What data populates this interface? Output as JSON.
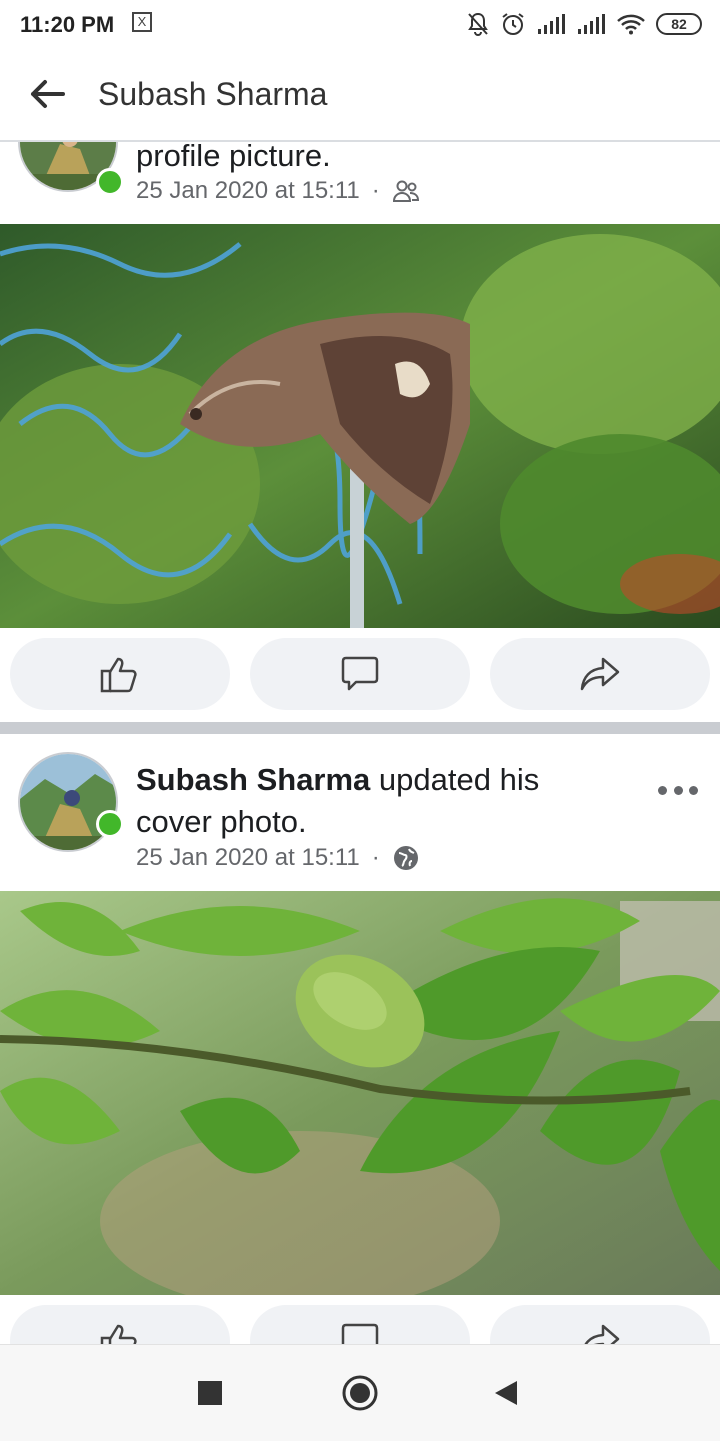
{
  "status_bar": {
    "time": "11:20 PM",
    "notification_glyph": "X",
    "battery": "82",
    "icons": [
      "notifications-off-icon",
      "alarm-icon",
      "signal-icon",
      "signal-icon",
      "wifi-icon",
      "battery-icon"
    ]
  },
  "header": {
    "title": "Subash Sharma",
    "back_icon": "arrow-left-icon"
  },
  "posts": [
    {
      "text_tail": "profile picture.",
      "timestamp": "25 Jan 2020 at 15:11",
      "separator": "·",
      "audience_icon": "friends-icon",
      "image": "moth on chain-link fence",
      "actions": [
        "like-icon",
        "comment-icon",
        "share-icon"
      ]
    },
    {
      "author": "Subash Sharma",
      "text_line1": " updated his",
      "text_line2": "cover photo.",
      "timestamp": "25 Jan 2020 at 15:11",
      "separator": "·",
      "audience_icon": "globe-icon",
      "image": "green fruit on branch with leaves",
      "actions": [
        "like-icon",
        "comment-icon",
        "share-icon"
      ]
    }
  ],
  "nav_bar": {
    "buttons": [
      "recents-square-icon",
      "home-circle-icon",
      "back-triangle-icon"
    ]
  },
  "colors": {
    "online": "#42b72a",
    "button_bg": "#f0f2f5",
    "meta_text": "#65676b",
    "separator": "#c9ccd1"
  }
}
